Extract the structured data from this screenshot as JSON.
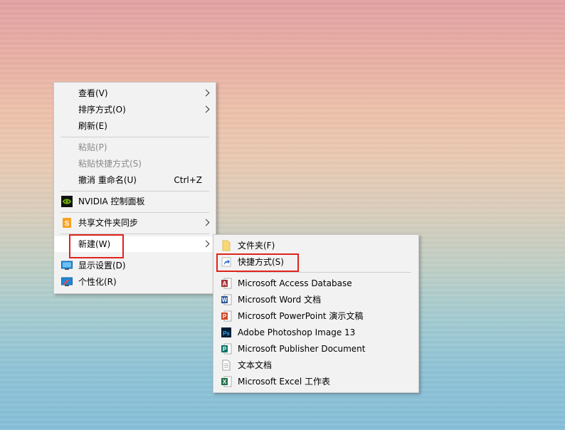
{
  "main_menu": {
    "view": "查看(V)",
    "sort": "排序方式(O)",
    "refresh": "刷新(E)",
    "paste": "粘贴(P)",
    "paste_shortcut": "粘贴快捷方式(S)",
    "undo": "撤消 重命名(U)",
    "undo_accel": "Ctrl+Z",
    "nvidia": "NVIDIA 控制面板",
    "share_sync": "共享文件夹同步",
    "new": "新建(W)",
    "display": "显示设置(D)",
    "personalize": "个性化(R)"
  },
  "new_submenu": {
    "folder": "文件夹(F)",
    "shortcut": "快捷方式(S)",
    "access": "Microsoft Access Database",
    "word": "Microsoft Word 文档",
    "powerpoint": "Microsoft PowerPoint 演示文稿",
    "photoshop": "Adobe Photoshop Image 13",
    "publisher": "Microsoft Publisher Document",
    "text": "文本文档",
    "excel": "Microsoft Excel 工作表"
  },
  "colors": {
    "highlight_box": "#e0231c",
    "menu_bg": "#f2f2f2",
    "disabled_text": "#8a8a8a"
  }
}
